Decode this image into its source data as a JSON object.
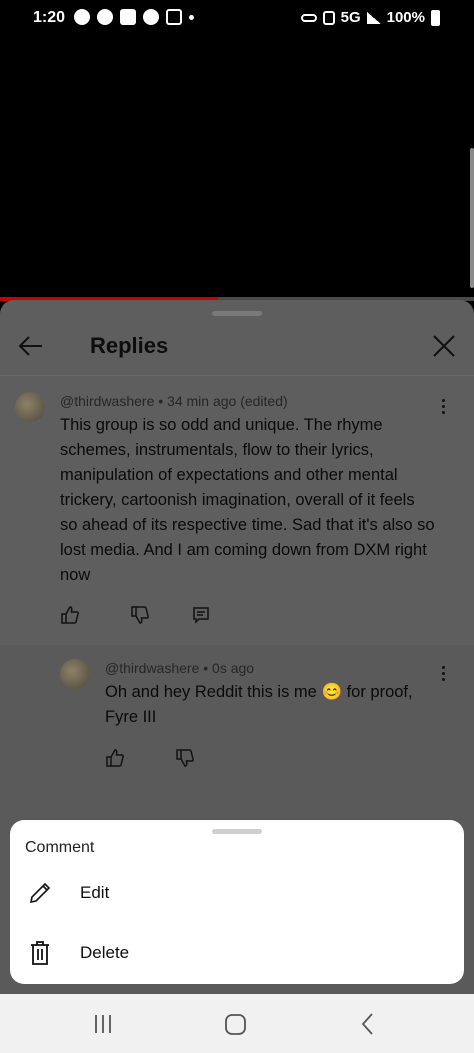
{
  "status_bar": {
    "time": "1:20",
    "network": "5G",
    "battery": "100%"
  },
  "video": {
    "progress_fraction": 0.46,
    "accent": "#cc0000"
  },
  "replies_panel": {
    "title": "Replies",
    "back_icon": "arrow-left-icon",
    "close_icon": "close-icon",
    "comments": [
      {
        "author": "@thirdwashere",
        "meta": "@thirdwashere • 34 min ago (edited)",
        "text": "This group is so odd and unique. The rhyme schemes, instrumentals, flow to their lyrics, manipulation of expectations and other mental trickery, cartoonish imagination, overall of it feels so ahead of its respective time. Sad that it's also so lost media. And I am coming down from DXM right now"
      },
      {
        "author": "@thirdwashere",
        "meta": "@thirdwashere • 0s ago",
        "text": "Oh and hey Reddit this is me 😊 for  proof, Fyre III"
      }
    ]
  },
  "sheet": {
    "title": "Comment",
    "items": [
      {
        "label": "Edit",
        "icon": "pencil-icon"
      },
      {
        "label": "Delete",
        "icon": "trash-icon"
      }
    ]
  },
  "nav_bar": {
    "recents_icon": "recent-apps-icon",
    "home_icon": "home-icon",
    "back_icon": "back-chevron-icon"
  }
}
